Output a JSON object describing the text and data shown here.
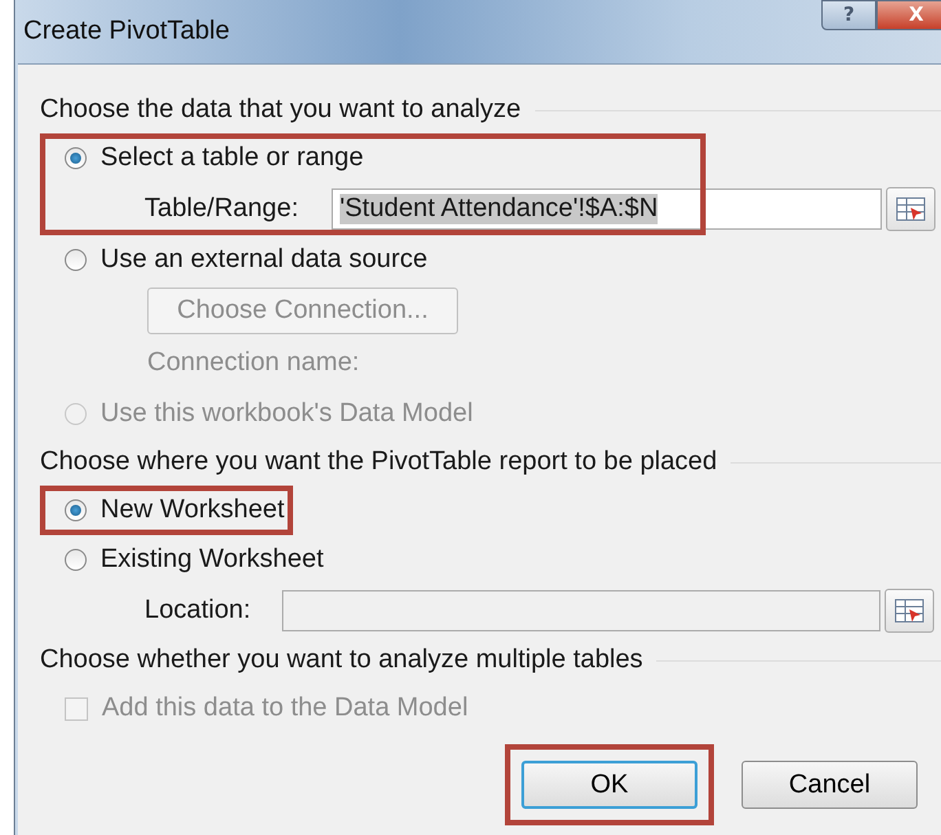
{
  "window": {
    "title": "Create PivotTable",
    "help_button": "?",
    "close_button": "X"
  },
  "sections": [
    {
      "heading": "Choose the data that you want to analyze",
      "items": [
        {
          "kind": "radio",
          "label": "Select a table or range",
          "selected": true,
          "disabled": false,
          "highlighted": true,
          "children": [
            {
              "kind": "field",
              "label": "Table/Range:",
              "value": "'Student Attendance'!$A:$N",
              "text_selected": true,
              "disabled": false
            }
          ]
        },
        {
          "kind": "radio",
          "label": "Use an external data source",
          "selected": false,
          "disabled": false,
          "children": [
            {
              "kind": "button",
              "label": "Choose Connection...",
              "disabled": true
            },
            {
              "kind": "label",
              "label": "Connection name:",
              "disabled": true
            }
          ]
        },
        {
          "kind": "radio",
          "label": "Use this workbook's Data Model",
          "selected": false,
          "disabled": true
        }
      ]
    },
    {
      "heading": "Choose where you want the PivotTable report to be placed",
      "items": [
        {
          "kind": "radio",
          "label": "New Worksheet",
          "selected": true,
          "disabled": false,
          "highlighted": true
        },
        {
          "kind": "radio",
          "label": "Existing Worksheet",
          "selected": false,
          "disabled": false,
          "children": [
            {
              "kind": "field",
              "label": "Location:",
              "disabled": true
            }
          ]
        }
      ]
    },
    {
      "heading": "Choose whether you want to analyze multiple tables",
      "items": [
        {
          "kind": "checkbox",
          "label": "Add this data to the Data Model",
          "checked": false,
          "disabled": true
        }
      ]
    }
  ],
  "buttons": [
    {
      "label": "OK",
      "default": true,
      "highlighted": true
    },
    {
      "label": "Cancel",
      "default": false,
      "highlighted": false
    }
  ]
}
